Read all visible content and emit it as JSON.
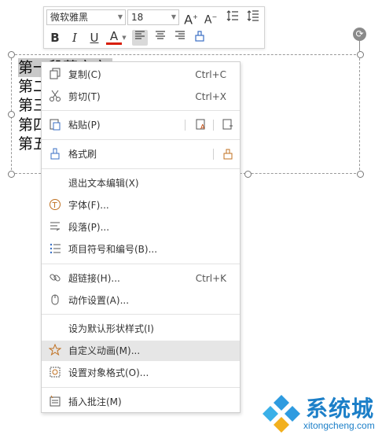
{
  "slide": {
    "lines": [
      "第一段落文字",
      "第二",
      "第三",
      "第四",
      "第五"
    ]
  },
  "toolbar": {
    "font_name": "微软雅黑",
    "font_size": "18",
    "buttons": {
      "grow_font": "A",
      "shrink_font": "A",
      "bold": "B",
      "italic": "I",
      "underline": "U",
      "font_color": "A"
    }
  },
  "context_menu": {
    "items": [
      {
        "label": "复制(C)",
        "shortcut": "Ctrl+C",
        "icon": "copy-icon"
      },
      {
        "label": "剪切(T)",
        "shortcut": "Ctrl+X",
        "icon": "scissors-icon"
      },
      {
        "label": "粘贴(P)",
        "shortcut": "",
        "icon": "paste-icon"
      },
      {
        "label": "格式刷",
        "shortcut": "",
        "icon": "format-painter-icon"
      },
      {
        "label": "退出文本编辑(X)",
        "shortcut": "",
        "icon": ""
      },
      {
        "label": "字体(F)...",
        "shortcut": "",
        "icon": "font-icon"
      },
      {
        "label": "段落(P)...",
        "shortcut": "",
        "icon": "paragraph-icon"
      },
      {
        "label": "项目符号和编号(B)...",
        "shortcut": "",
        "icon": "bullets-icon"
      },
      {
        "label": "超链接(H)...",
        "shortcut": "Ctrl+K",
        "icon": "link-icon"
      },
      {
        "label": "动作设置(A)...",
        "shortcut": "",
        "icon": "mouse-icon"
      },
      {
        "label": "设为默认形状样式(I)",
        "shortcut": "",
        "icon": ""
      },
      {
        "label": "自定义动画(M)...",
        "shortcut": "",
        "icon": "star-animation-icon",
        "highlighted": true
      },
      {
        "label": "设置对象格式(O)...",
        "shortcut": "",
        "icon": "object-format-icon"
      },
      {
        "label": "插入批注(M)",
        "shortcut": "",
        "icon": "comment-icon"
      }
    ]
  },
  "watermark": {
    "title": "系统城",
    "subtitle": "xitongcheng.com"
  }
}
